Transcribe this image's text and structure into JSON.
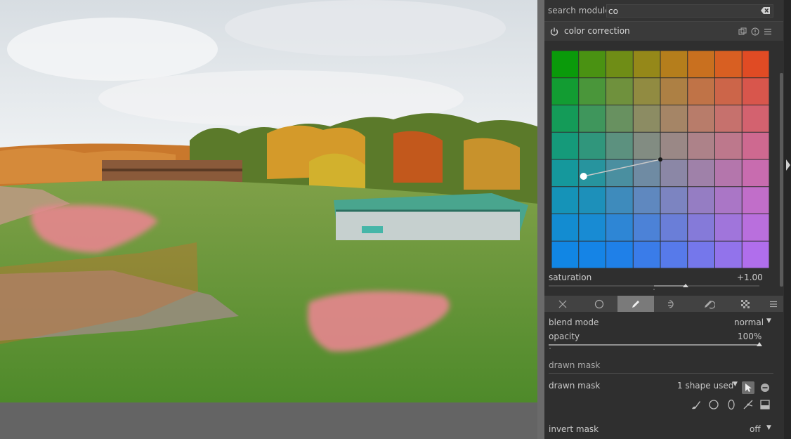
{
  "search": {
    "label": "search module",
    "value": "co"
  },
  "module": {
    "title": "color correction"
  },
  "grid": {
    "rows": [
      [
        "#0a9a0a",
        "#4a9212",
        "#6f8d16",
        "#958819",
        "#b57e1c",
        "#c9701f",
        "#d85f22",
        "#e04b24"
      ],
      [
        "#129c32",
        "#4a963a",
        "#6f913d",
        "#918b41",
        "#ad8044",
        "#c07347",
        "#cc6549",
        "#d8564c"
      ],
      [
        "#149b58",
        "#3f965c",
        "#689160",
        "#8c8c63",
        "#a58566",
        "#b87c6a",
        "#c6716d",
        "#d3626f"
      ],
      [
        "#159a7a",
        "#30967c",
        "#5c917f",
        "#828c82",
        "#9a8886",
        "#ad8289",
        "#bd788c",
        "#ce6990"
      ],
      [
        "#15989c",
        "#27949e",
        "#4a8fa0",
        "#6f8ba3",
        "#8b87a6",
        "#9f81a9",
        "#b476ac",
        "#c86caf"
      ],
      [
        "#1593b8",
        "#1d90ba",
        "#3e8bbc",
        "#5f88bf",
        "#7c84c1",
        "#957dc3",
        "#aa76c6",
        "#c16ec9"
      ],
      [
        "#138cd1",
        "#188bd3",
        "#2e86d5",
        "#4c82d7",
        "#6a7ed8",
        "#857ad9",
        "#a075db",
        "#b96fdd"
      ],
      [
        "#1186e4",
        "#1584e6",
        "#1f80e8",
        "#3a7ce9",
        "#577aea",
        "#7577eb",
        "#9273eb",
        "#b06eec"
      ]
    ],
    "point_from": {
      "col": 1.18,
      "row": 4.62
    },
    "point_to": {
      "col": 4.0,
      "row": 4.0
    }
  },
  "saturation": {
    "label": "saturation",
    "value": "+1.00",
    "level": 0.65
  },
  "tabs": [
    "off",
    "uniformly",
    "drawn mask",
    "parametric mask",
    "drawn & parametric mask",
    "raster mask"
  ],
  "blend": {
    "label": "blend mode",
    "value": "normal"
  },
  "opacity": {
    "label": "opacity",
    "value": "100%",
    "level": 1.0
  },
  "drawn_mask_section": {
    "title": "drawn mask"
  },
  "drawn_mask": {
    "label": "drawn mask",
    "value": "1 shape used"
  },
  "invert": {
    "label": "invert mask",
    "value": "off"
  },
  "colors": {
    "accent_point": "#ffffff"
  }
}
